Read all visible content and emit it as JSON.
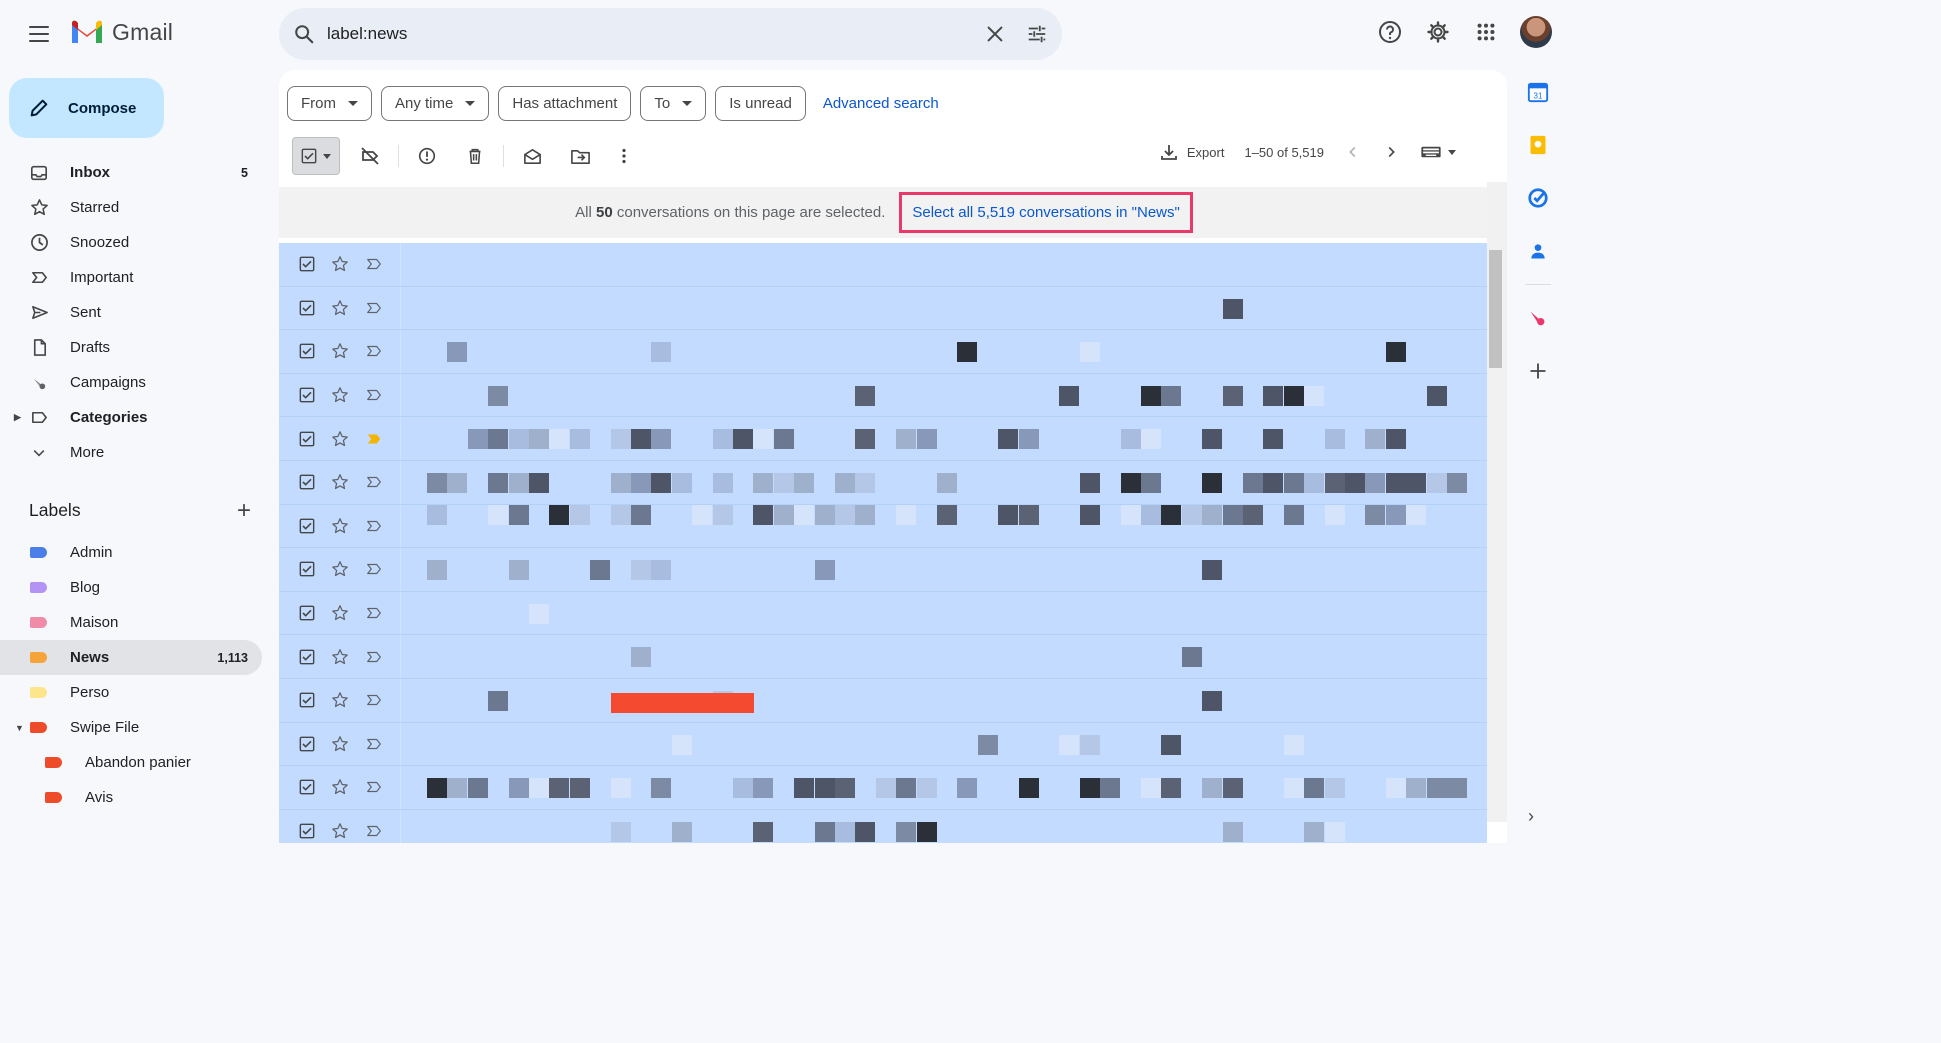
{
  "app": {
    "name": "Gmail"
  },
  "search": {
    "value": "label:news"
  },
  "compose": {
    "label": "Compose"
  },
  "nav": [
    {
      "label": "Inbox",
      "count": "5",
      "icon": "inbox-icon",
      "bold": true
    },
    {
      "label": "Starred",
      "count": "",
      "icon": "star-icon"
    },
    {
      "label": "Snoozed",
      "count": "",
      "icon": "clock-icon"
    },
    {
      "label": "Important",
      "count": "",
      "icon": "important-icon"
    },
    {
      "label": "Sent",
      "count": "",
      "icon": "send-icon"
    },
    {
      "label": "Drafts",
      "count": "",
      "icon": "draft-icon"
    },
    {
      "label": "Campaigns",
      "count": "",
      "icon": "campaign-icon"
    },
    {
      "label": "Categories",
      "count": "",
      "icon": "label-outline-icon",
      "bold": true
    },
    {
      "label": "More",
      "count": "",
      "icon": "chevron-down-icon"
    }
  ],
  "labels": {
    "title": "Labels",
    "items": [
      {
        "label": "Admin",
        "count": "",
        "color": "#4a7ee8"
      },
      {
        "label": "Blog",
        "count": "",
        "color": "#b394f5"
      },
      {
        "label": "Maison",
        "count": "",
        "color": "#f08ca8"
      },
      {
        "label": "News",
        "count": "1,113",
        "color": "#f6a43a",
        "active": true
      },
      {
        "label": "Perso",
        "count": "",
        "color": "#fce58a"
      },
      {
        "label": "Swipe File",
        "count": "",
        "color": "#ee4b2b"
      },
      {
        "label": "Abandon panier",
        "count": "",
        "color": "#ee4b2b",
        "sub": true
      },
      {
        "label": "Avis",
        "count": "",
        "color": "#ee4b2b",
        "sub": true
      }
    ]
  },
  "filters": {
    "chips": [
      "From",
      "Any time",
      "Has attachment",
      "To",
      "Is unread"
    ],
    "advanced": "Advanced search"
  },
  "toolbar": {
    "export": "Export",
    "pagination": "1–50 of 5,519"
  },
  "banner": {
    "prefix": "All",
    "count": "50",
    "suffix": "conversations on this page are selected.",
    "select_all": "Select all 5,519 conversations in \"News\""
  },
  "colors": {
    "accent": "#0b57d0",
    "selected_row": "#c2dbff",
    "highlight_border": "#e8396a",
    "compose_bg": "#c2e7ff"
  }
}
